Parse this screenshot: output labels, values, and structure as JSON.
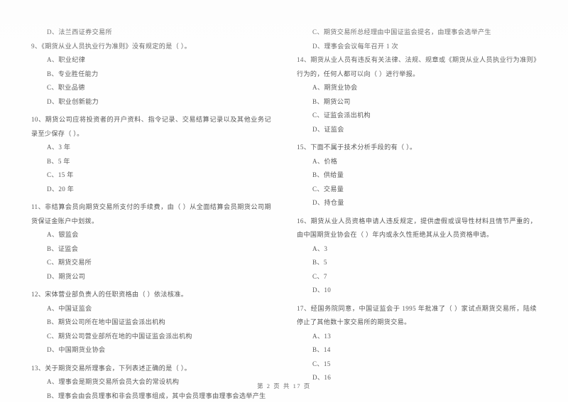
{
  "document": {
    "language": "zh-CN",
    "page_footer": "第 2 页  共 17 页",
    "background_color": "#ffffff",
    "text_color": "#575757"
  },
  "left_column": {
    "orphan_option": "D、法兰西证券交易所",
    "questions": [
      {
        "number": "9",
        "stem": "9、《期货从业人员执业行为准则》没有规定的是（      ）。",
        "options": [
          "A、职业纪律",
          "B、专业胜任能力",
          "C、职业品德",
          "D、职业创新能力"
        ]
      },
      {
        "number": "10",
        "stem": "10、期货公司应将投资者的开户资料、指令记录、交易结算记录以及其他业务记录至少保存（      ）。",
        "options": [
          "A、3 年",
          "B、5 年",
          "C、15 年",
          "D、20 年"
        ]
      },
      {
        "number": "11",
        "stem": "11、非结算会员向期货交易所支付的手续费，由（      ）从全面结算会员期货公司期货保证金账户中划拨。",
        "options": [
          "A、银监会",
          "B、证监会",
          "C、期货交易所",
          "D、期货公司"
        ]
      },
      {
        "number": "12",
        "stem": "12、宋体营业部负责人的任职资格由（      ）依法核准。",
        "options": [
          "A、中国证监会",
          "B、期货公司所在地中国证监会派出机构",
          "C、期货公司营业部所在地的中国证监会派出机构",
          "D、中国期货业协会"
        ]
      },
      {
        "number": "13",
        "stem": "13、关于期货交易所理事会，下列表述正确的是（      ）。",
        "options": [
          "A、理事会是期货交易所会员大会的常设机构",
          "B、理事会由会员理事和非会员理事组成，其中会员理事由理事会选举产生"
        ]
      }
    ]
  },
  "right_column": {
    "orphan_options": [
      "C、期货交易所总经理由中国证监会提名，由理事会选举产生",
      "D、理事会会议每年召开 1 次"
    ],
    "questions": [
      {
        "number": "14",
        "stem": "14、期货从业人员有违反有关法律、法规、规章或《期货从业人员执业行为准则》行为的，任何人都可以向（      ）进行举报。",
        "options": [
          "A、期货业协会",
          "B、期货公司",
          "C、证监会派出机构",
          "D、证监会"
        ]
      },
      {
        "number": "15",
        "stem": "15、下面不属于技术分析手段的有（      ）。",
        "options": [
          "A、价格",
          "B、供给量",
          "C、交易量",
          "D、持仓量"
        ]
      },
      {
        "number": "16",
        "stem": "16、期货从业人员资格申请人违反规定，提供虚假或误导性材料且情节严重的，由中国期货业协会在（      ）年内或永久性拒绝其从业人员资格申请。",
        "options": [
          "A、3",
          "B、5",
          "C、7",
          "D、10"
        ]
      },
      {
        "number": "17",
        "stem": "17、经国务院同意，中国证监会于 1995 年批准了（      ）家试点期货交易所，陆续停止了其他数十家交易所的期货交易。",
        "options": [
          "A、13",
          "B、14",
          "C、15",
          "D、16"
        ]
      }
    ]
  }
}
